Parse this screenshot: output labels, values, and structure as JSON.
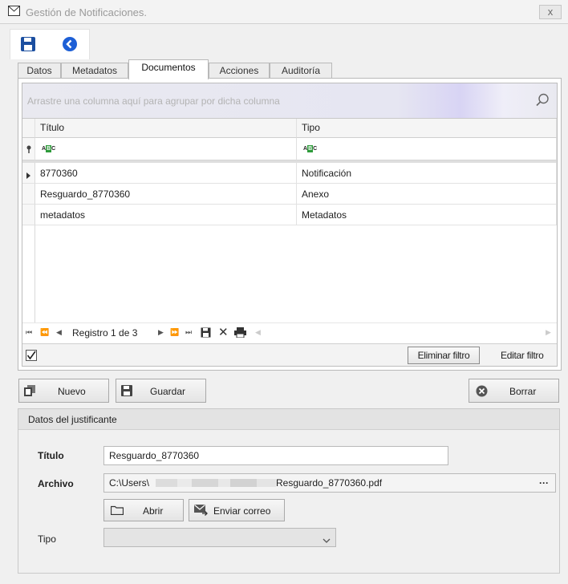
{
  "window": {
    "title": "Gestión de Notificaciones.",
    "close_label": "x"
  },
  "tabs": [
    {
      "label": "Datos"
    },
    {
      "label": "Metadatos"
    },
    {
      "label": "Documentos"
    },
    {
      "label": "Acciones"
    },
    {
      "label": "Auditoría"
    }
  ],
  "grid": {
    "group_panel_text": "Arrastre una columna aquí para agrupar por dicha columna",
    "columns": [
      "Título",
      "Tipo"
    ],
    "filter_glyph": "ABC",
    "rows": [
      {
        "titulo": "8770360",
        "tipo": "Notificación"
      },
      {
        "titulo": "Resguardo_8770360",
        "tipo": "Anexo"
      },
      {
        "titulo": "metadatos",
        "tipo": "Metadatos"
      }
    ],
    "navigator_text": "Registro 1 de 3",
    "remove_filter_label": "Eliminar filtro",
    "edit_filter_label": "Editar filtro"
  },
  "actions": {
    "new_label": "Nuevo",
    "save_label": "Guardar",
    "delete_label": "Borrar"
  },
  "justificante": {
    "title": "Datos del justificante",
    "titulo_label": "Título",
    "titulo_value": "Resguardo_8770360",
    "archivo_label": "Archivo",
    "archivo_prefix": "C:\\Users\\",
    "archivo_suffix": "Resguardo_8770360.pdf",
    "archivo_more": "···",
    "open_label": "Abrir",
    "send_mail_label": "Enviar correo",
    "tipo_label": "Tipo",
    "tipo_value": ""
  },
  "colors": {
    "save_blue": "#1c4fa0",
    "back_blue": "#1d5fd6",
    "grid_check_green": "#2e9b3b"
  }
}
